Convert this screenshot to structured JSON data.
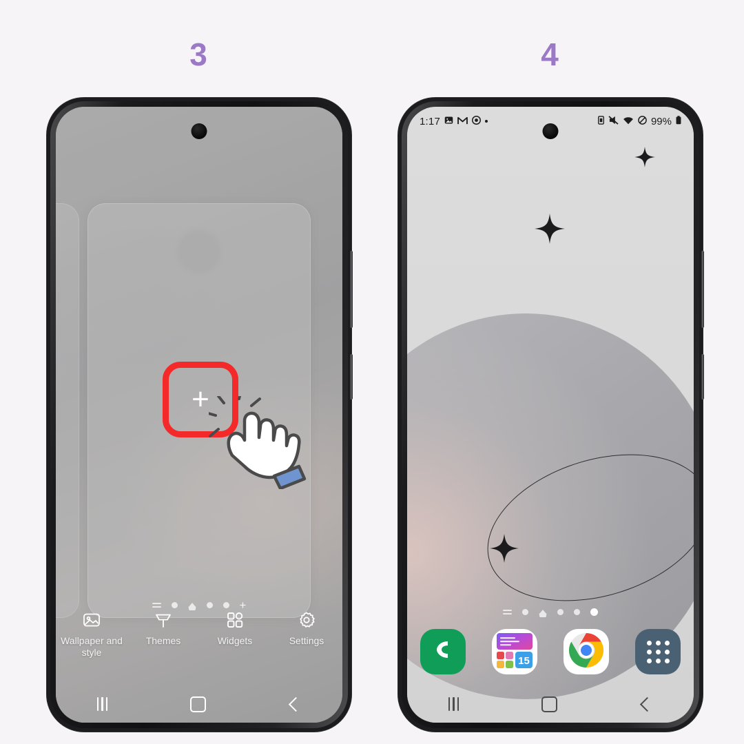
{
  "steps": {
    "left_number": "3",
    "right_number": "4",
    "accent_color": "#9b79c6"
  },
  "left_phone": {
    "mode_label": "home-screen-edit",
    "highlight_color": "#f42a2a",
    "add_button_glyph": "+",
    "toolbar": [
      {
        "id": "wallpaper-and-style",
        "label": "Wallpaper and style",
        "icon": "image-icon"
      },
      {
        "id": "themes",
        "label": "Themes",
        "icon": "paint-roller-icon"
      },
      {
        "id": "widgets",
        "label": "Widgets",
        "icon": "widgets-grid-icon"
      },
      {
        "id": "settings",
        "label": "Settings",
        "icon": "gear-icon"
      }
    ],
    "page_indicator": [
      {
        "type": "lines"
      },
      {
        "type": "dot"
      },
      {
        "type": "home"
      },
      {
        "type": "dot"
      },
      {
        "type": "dot"
      },
      {
        "type": "plus",
        "glyph": "+"
      }
    ],
    "nav_bar": [
      {
        "id": "recents",
        "icon": "recents-icon"
      },
      {
        "id": "home",
        "icon": "home-square-icon"
      },
      {
        "id": "back",
        "icon": "back-chevron-icon"
      }
    ]
  },
  "right_phone": {
    "status_bar": {
      "time": "1:17",
      "notification_icons": [
        "photo-icon",
        "gmail-icon",
        "clock-icon"
      ],
      "overflow_dot": "•",
      "system_icons": [
        "sim-card-icon",
        "mute-icon",
        "wifi-icon",
        "do-not-disturb-icon"
      ],
      "battery_percent": "99%",
      "battery_icon": "battery-full-icon"
    },
    "wallpaper": {
      "name": "planet-sparkles-wallpaper",
      "elements": [
        "planet-sphere",
        "orbit-ring",
        "sparkle-star"
      ]
    },
    "page_indicator": [
      {
        "type": "lines"
      },
      {
        "type": "dot"
      },
      {
        "type": "home"
      },
      {
        "type": "dot"
      },
      {
        "type": "dot"
      },
      {
        "type": "dot-active"
      }
    ],
    "dock": [
      {
        "id": "phone",
        "label": "Phone",
        "icon": "phone-handset-icon",
        "color": "#0f9d58"
      },
      {
        "id": "widgets-app",
        "label": "Widgets",
        "icon": "widgets-app-icon",
        "color": "#ffffff"
      },
      {
        "id": "chrome",
        "label": "Chrome",
        "icon": "chrome-icon",
        "color": "#ffffff"
      },
      {
        "id": "app-drawer",
        "label": "Apps",
        "icon": "apps-grid-icon",
        "color": "#4a6173"
      }
    ],
    "nav_bar": [
      {
        "id": "recents",
        "icon": "recents-icon"
      },
      {
        "id": "home",
        "icon": "home-square-icon"
      },
      {
        "id": "back",
        "icon": "back-chevron-icon"
      }
    ]
  }
}
